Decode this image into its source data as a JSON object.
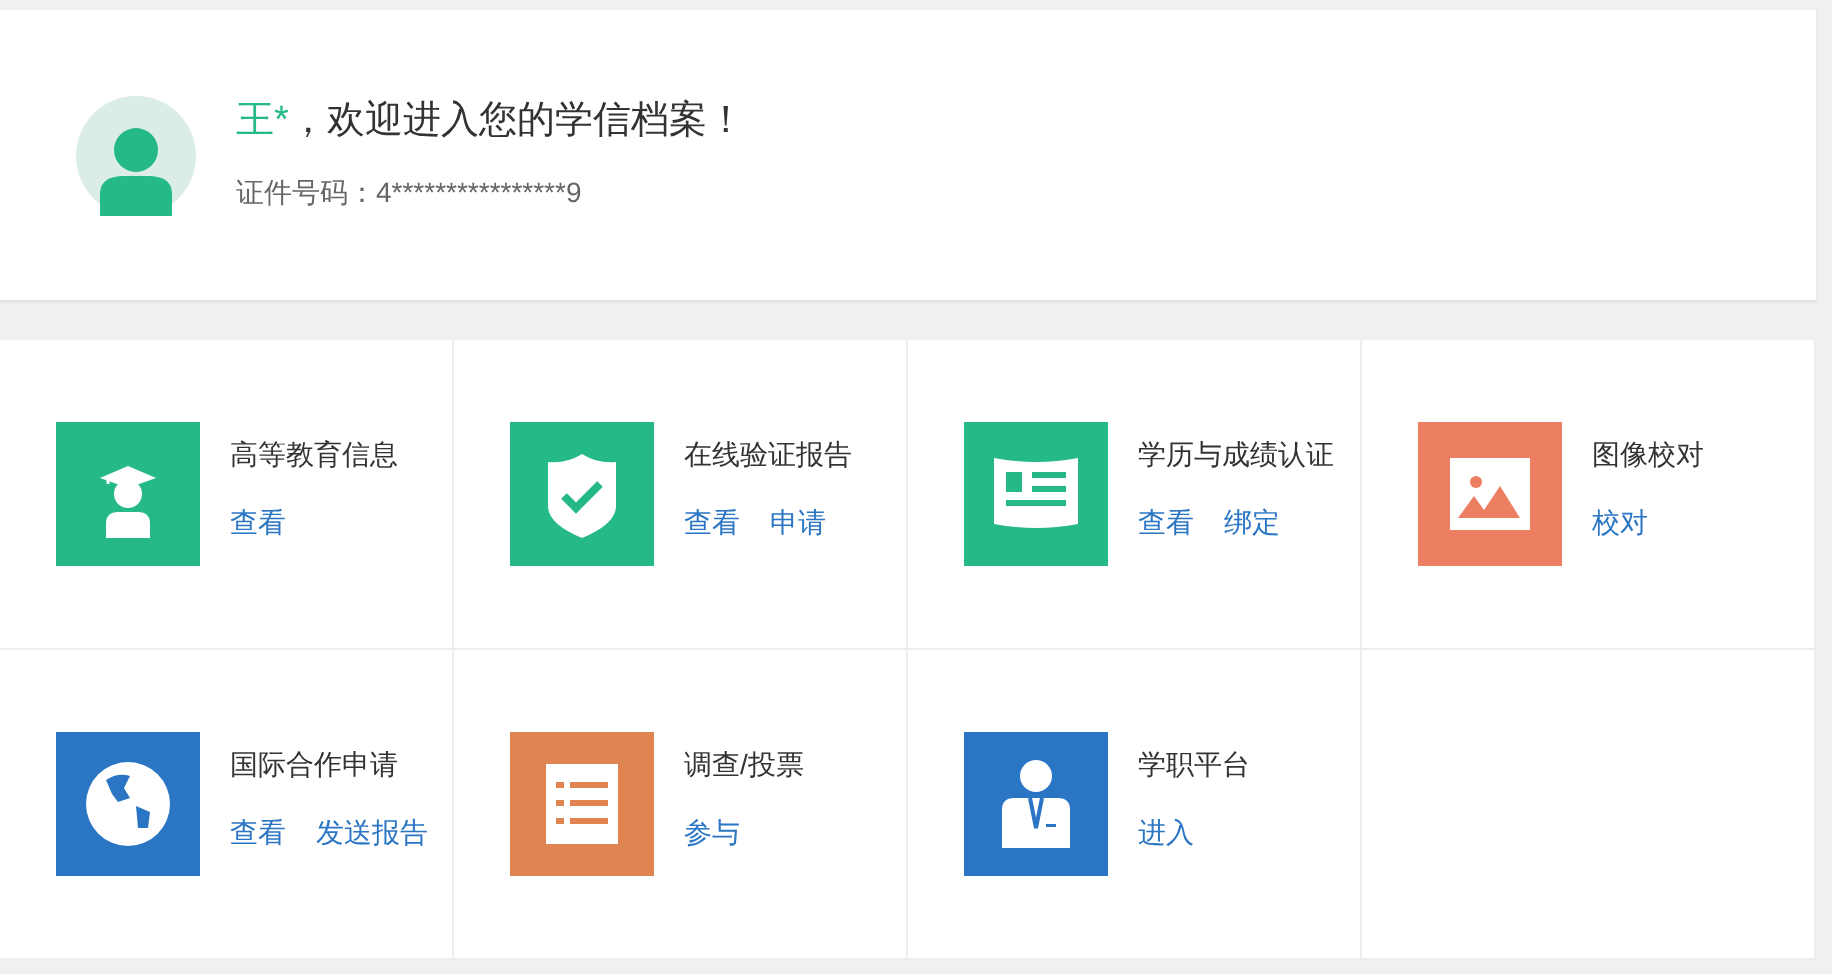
{
  "profile": {
    "name": "王*",
    "greeting": "，欢迎进入您的学信档案！",
    "id_number": "证件号码：4****************9"
  },
  "services": [
    {
      "title": "高等教育信息",
      "kind": "graduate",
      "color": "#25b985",
      "links": [
        "查看"
      ]
    },
    {
      "title": "在线验证报告",
      "kind": "shield",
      "color": "#25b985",
      "links": [
        "查看",
        "申请"
      ]
    },
    {
      "title": "学历与成绩认证",
      "kind": "document",
      "color": "#25b985",
      "links": [
        "查看",
        "绑定"
      ]
    },
    {
      "title": "图像校对",
      "kind": "image",
      "color": "#ec7f62",
      "links": [
        "校对"
      ]
    },
    {
      "title": "国际合作申请",
      "kind": "globe",
      "color": "#2b76c4",
      "links": [
        "查看",
        "发送报告"
      ]
    },
    {
      "title": "调查/投票",
      "kind": "list",
      "color": "#df8451",
      "links": [
        "参与"
      ]
    },
    {
      "title": "学职平台",
      "kind": "person",
      "color": "#2b76c4",
      "links": [
        "进入"
      ]
    }
  ]
}
